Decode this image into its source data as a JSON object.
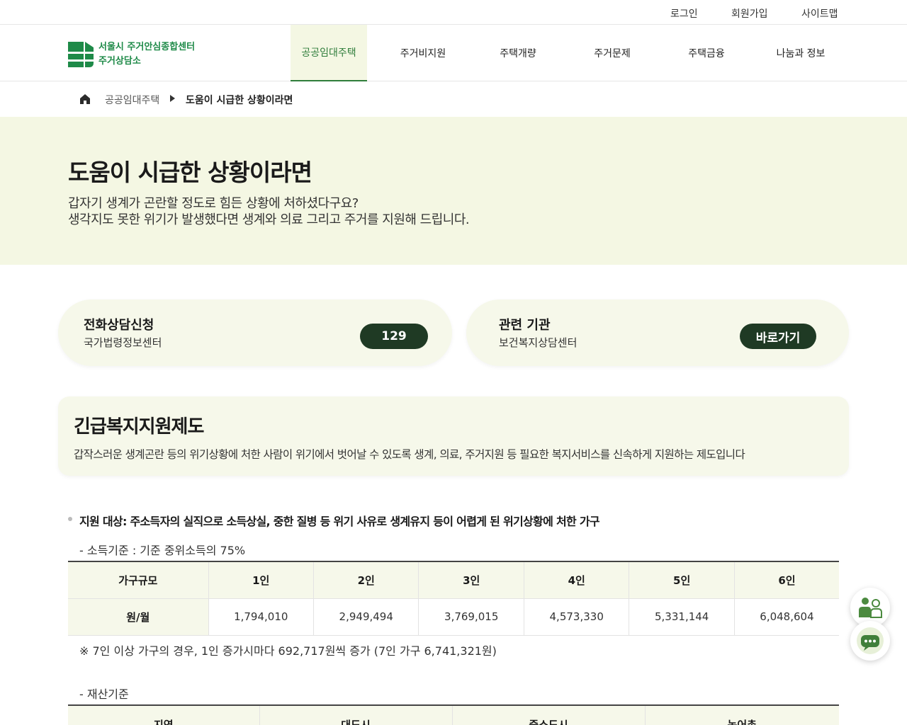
{
  "util_links": [
    "로그인",
    "회원가입",
    "사이트맵"
  ],
  "logo": {
    "line1": "서울시 주거안심종합센터",
    "line2": "주거상담소"
  },
  "nav": [
    "공공임대주택",
    "주거비지원",
    "주택개량",
    "주거문제",
    "주택금융",
    "나눔과 정보"
  ],
  "breadcrumb": {
    "parent": "공공임대주택",
    "current": "도움이 시급한 상황이라면"
  },
  "hero": {
    "title": "도움이 시급한 상황이라면",
    "desc1": "갑자기 생계가 곤란할 정도로 힘든 상황에 처하셨다구요?",
    "desc2": "생각지도 못한 위기가 발생했다면 생계와 의료 그리고 주거를 지원해 드립니다."
  },
  "cards": [
    {
      "title": "전화상담신청",
      "sub": "국가법령정보센터",
      "button": "129"
    },
    {
      "title": "관련 기관",
      "sub": "보건복지상담센터",
      "button": "바로가기"
    }
  ],
  "info": {
    "title": "긴급복지지원제도",
    "desc": "갑작스러운 생계곤란 등의 위기상황에 처한 사람이 위기에서 벗어날 수 있도록 생계, 의료, 주거지원 등 필요한 복지서비스를 신속하게 지원하는 제도입니다"
  },
  "support": {
    "target": "지원 대상: 주소득자의 실직으로 소득상실, 중한 질병 등 위기 사유로 생계유지 등이 어렵게 된 위기상황에 처한 가구",
    "income_label": "- 소득기준 : 기준 중위소득의 75%",
    "income_table": {
      "headers": [
        "가구규모",
        "1인",
        "2인",
        "3인",
        "4인",
        "5인",
        "6인"
      ],
      "row_label": "원/월",
      "values": [
        "1,794,010",
        "2,949,494",
        "3,769,015",
        "4,573,330",
        "5,331,144",
        "6,048,604"
      ]
    },
    "note": "※ 7인 이상 가구의 경우, 1인 증가시마다 692,717원씩 증가 (7인 가구 6,741,321원)",
    "asset_label": "- 재산기준",
    "asset_headers": [
      "지역",
      "대도시",
      "중소도시",
      "농어촌"
    ]
  },
  "colors": {
    "accent_green": "#2f7d3b",
    "logo_green": "#1e8a48",
    "light_bg": "#f4f7e3",
    "pill_dark": "#1f3a24"
  },
  "fab_icons": [
    "counselor-icon",
    "chatbot-icon"
  ]
}
